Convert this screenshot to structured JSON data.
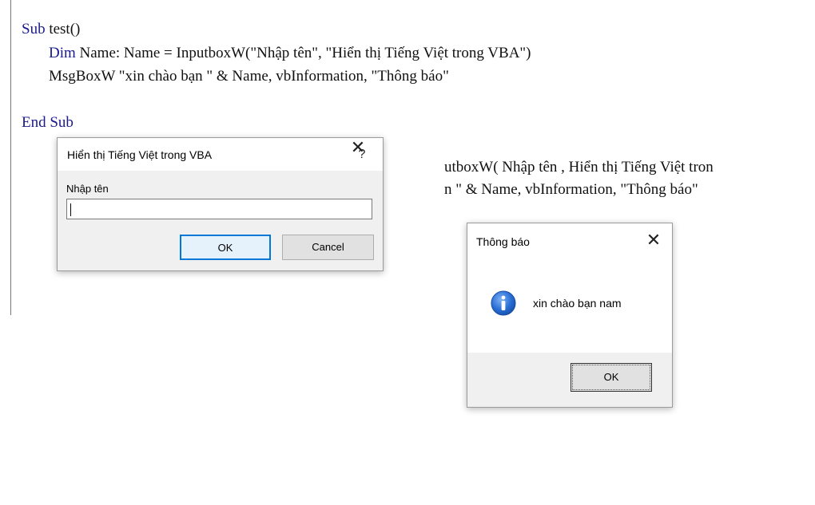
{
  "code": {
    "sub_kw": "Sub",
    "sub_name": " test()",
    "dim_kw": "Dim",
    "dim_rest": " Name: Name = InputboxW(\"Nhập tên\", \"Hiển thị Tiếng Việt trong VBA\")",
    "msgbox_line": "MsgBoxW \"xin chào bạn \" & Name, vbInformation, \"Thông báo\"",
    "end_sub": "End Sub",
    "bg_line1": "utboxW( Nhập tên , Hiển thị Tiếng Việt tron",
    "bg_line2": "n \" & Name, vbInformation, \"Thông báo\""
  },
  "inputbox": {
    "title": "Hiển thị Tiếng Việt trong VBA",
    "help": "?",
    "close": "✕",
    "prompt": "Nhập tên",
    "value": "",
    "ok_label": "OK",
    "cancel_label": "Cancel"
  },
  "msgbox": {
    "title": "Thông báo",
    "close": "✕",
    "icon": "information-icon",
    "message": "xin chào bạn nam",
    "ok_label": "OK"
  },
  "colors": {
    "keyword": "#1a1a8c",
    "focus_border": "#0078d7",
    "info_blue": "#1f5fc8"
  }
}
